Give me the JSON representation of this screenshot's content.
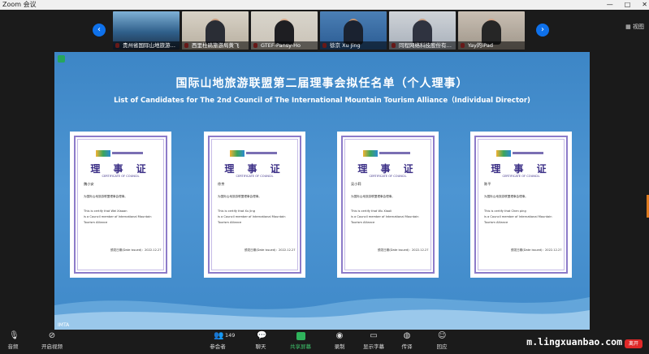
{
  "app": {
    "title": "Zoom 会议"
  },
  "window_controls": [
    "—",
    "□",
    "✕"
  ],
  "strip": {
    "prev_icon": "chevron-left-icon",
    "next_icon": "chevron-right-icon",
    "view_label": "视图",
    "participants": [
      {
        "name": "贵州省国际山地旅游…"
      },
      {
        "name": "西里杜鹃旅游局黄飞"
      },
      {
        "name": "GTEF-Pansy-Ho"
      },
      {
        "name": "徐京 Xu Jing"
      },
      {
        "name": "同程网络科技股份有…"
      },
      {
        "name": "Yay的iPad"
      }
    ]
  },
  "share": {
    "title_cn": "国际山地旅游联盟第二届理事会拟任名单（个人理事）",
    "title_en": "List of Candidates for The 2nd Council of The International Mountain Tourism Alliance（Individual Director)",
    "footer_label": "IMTA",
    "certificates": [
      {
        "title": "理 事 证",
        "subtitle": "CERTIFICATE OF COUNCIL",
        "name_cn": "魏小安",
        "line1": "为国际山地旅游联盟理事会理事。",
        "line2": "This is certify that     Wei Xiaoan",
        "line3": "is a Council member of International Mountain",
        "line4": "Tourism Alliance",
        "date": "颁发日期(Date issued)：2022.12.27"
      },
      {
        "title": "理 事 证",
        "subtitle": "CERTIFICATE OF COUNCIL",
        "name_cn": "徐京",
        "line1": "为国际山地旅游联盟理事会理事。",
        "line2": "This is certify that     Xu Jing",
        "line3": "is a Council member of International Mountain",
        "line4": "Tourism Alliance",
        "date": "颁发日期(Date issued)：2022.12.27"
      },
      {
        "title": "理 事 证",
        "subtitle": "CERTIFICATE OF COUNCIL",
        "name_cn": "吴小莉",
        "line1": "为国际山地旅游联盟理事会理事。",
        "line2": "This is certify that     Wu Xiaoli",
        "line3": "is a Council member of International Mountain",
        "line4": "Tourism Alliance",
        "date": "颁发日期(Date issued)：2022.12.27"
      },
      {
        "title": "理 事 证",
        "subtitle": "CERTIFICATE OF COUNCIL",
        "name_cn": "陈平",
        "line1": "为国际山地旅游联盟理事会理事。",
        "line2": "This is certify that     Chen ping",
        "line3": "is a Council member of International Mountain",
        "line4": "Tourism Alliance",
        "date": "颁发日期(Date issued)：2022.12.27"
      }
    ]
  },
  "toolbar": {
    "mute": "音频",
    "video": "开启视频",
    "participants": "参会者",
    "participants_count": "149",
    "chat": "聊天",
    "share_screen": "共享屏幕",
    "record": "录制",
    "captions": "显示字幕",
    "translate": "传译",
    "reactions": "回应",
    "leave": "离开"
  },
  "watermark": "m.lingxuanbao.com",
  "colors": {
    "accent": "#0e71eb",
    "share_green": "#2fb35b",
    "leave_red": "#e02828",
    "cert_purple": "#3b2f86"
  }
}
